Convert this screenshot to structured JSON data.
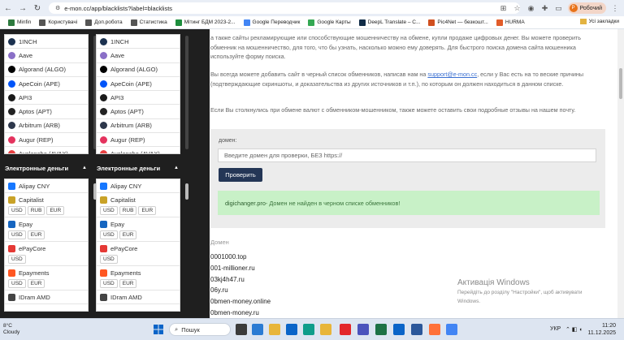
{
  "browser": {
    "url": "e-mon.cc/app/blacklists?label=blacklists",
    "profile_initial": "Р",
    "profile_name": "Робочий"
  },
  "bookmarks": [
    {
      "label": "Minfin",
      "color": "#2d7a3f"
    },
    {
      "label": "Користувачі",
      "color": "#555555"
    },
    {
      "label": "Доп.робота",
      "color": "#555555"
    },
    {
      "label": "Статистика",
      "color": "#555555"
    },
    {
      "label": "Мітинг БДМ 2023-2...",
      "color": "#1e8e3e"
    },
    {
      "label": "Google Переводчик",
      "color": "#4285f4"
    },
    {
      "label": "Google Карты",
      "color": "#34a853"
    },
    {
      "label": "DeepL Translate – С...",
      "color": "#0f2b46"
    },
    {
      "label": "Pic4Net — безкошт...",
      "color": "#d04f1f"
    },
    {
      "label": "HURMA",
      "color": "#e25d2a"
    }
  ],
  "bookmarks_all": "Усі закладки",
  "crypto_list": [
    {
      "label": "1INCH",
      "icon": "1inch-icon",
      "color": "#1b314f"
    },
    {
      "label": "Aave",
      "icon": "aave-icon",
      "color": "#8a6fc7"
    },
    {
      "label": "Algorand (ALGO)",
      "icon": "algorand-icon",
      "color": "#000000"
    },
    {
      "label": "ApeCoin (APE)",
      "icon": "apecoin-icon",
      "color": "#0054f9"
    },
    {
      "label": "API3",
      "icon": "api3-icon",
      "color": "#1a1a1a"
    },
    {
      "label": "Aptos (APT)",
      "icon": "aptos-icon",
      "color": "#222222"
    },
    {
      "label": "Arbitrum (ARB)",
      "icon": "arbitrum-icon",
      "color": "#2d374b"
    },
    {
      "label": "Augur (REP)",
      "icon": "augur-icon",
      "color": "#e4335e"
    },
    {
      "label": "Avalanche (AVAX)",
      "icon": "avalanche-icon",
      "color": "#e84142"
    }
  ],
  "category_title": "Электронные деньги",
  "emoney_list": [
    {
      "label": "Alipay CNY",
      "icon": "alipay-icon",
      "color": "#1677ff",
      "tags": []
    },
    {
      "label": "Capitalist",
      "icon": "capitalist-icon",
      "color": "#c9a227",
      "tags": [
        "USD",
        "RUB",
        "EUR"
      ]
    },
    {
      "label": "Epay",
      "icon": "epay-icon",
      "color": "#1565c0",
      "tags": [
        "USD",
        "EUR"
      ]
    },
    {
      "label": "ePayCore",
      "icon": "epaycore-icon",
      "color": "#e53935",
      "tags": [
        "USD"
      ]
    },
    {
      "label": "Epayments",
      "icon": "epayments-icon",
      "color": "#ff5722",
      "tags": [
        "USD",
        "EUR"
      ]
    },
    {
      "label": "IDram AMD",
      "icon": "idram-icon",
      "color": "#444444",
      "tags": []
    }
  ],
  "main": {
    "intro": "а также сайты рекламирующие или способствующие мошенничеству на обмене, купли продаже цифровых денег. Вы можете проверить обменник на мошенничество, для того, что бы узнать, насколько можно ему доверять. Для быстрого поиска домена сайта мошенника используйте форму поиска.",
    "add_text_before": "Вы всегда можете добавить сайт в черный список обменников, написав нам на ",
    "email": "support@e-mon.cc",
    "add_text_after": ", если у Вас есть на то веские причины (подтверждающие скриншоты, и доказательства из других источников и т.п.), по которым он должен находиться в данном списке.",
    "review_text": "Если Вы столкнулись при обмене валют с обменником-мошенником, также можете оставить свои подробные отзывы на нашем почту.",
    "form_label": "домен:",
    "input_placeholder": "Введите домен для проверки, БЕЗ https://",
    "check_button": "Проверить",
    "result_domain": "digichanger.pro",
    "result_text": " - Домен не найден в черном списке обменников!",
    "domains_header": "Домен",
    "domains": [
      "0001000.top",
      "001-millioner.ru",
      "03kj4h47.ru",
      "06y.ru",
      "0bmen-money.online",
      "0bmen-money.ru"
    ]
  },
  "windows_watermark": {
    "title": "Активація Windows",
    "line1": "Перейдіть до розділу \"Настройки\", щоб активувати",
    "line2": "Windows."
  },
  "taskbar": {
    "temp": "8°C",
    "weather": "Cloudy",
    "search": "Пошук",
    "lang": "УКР",
    "time": "11:20",
    "date": "11.12.2025"
  }
}
